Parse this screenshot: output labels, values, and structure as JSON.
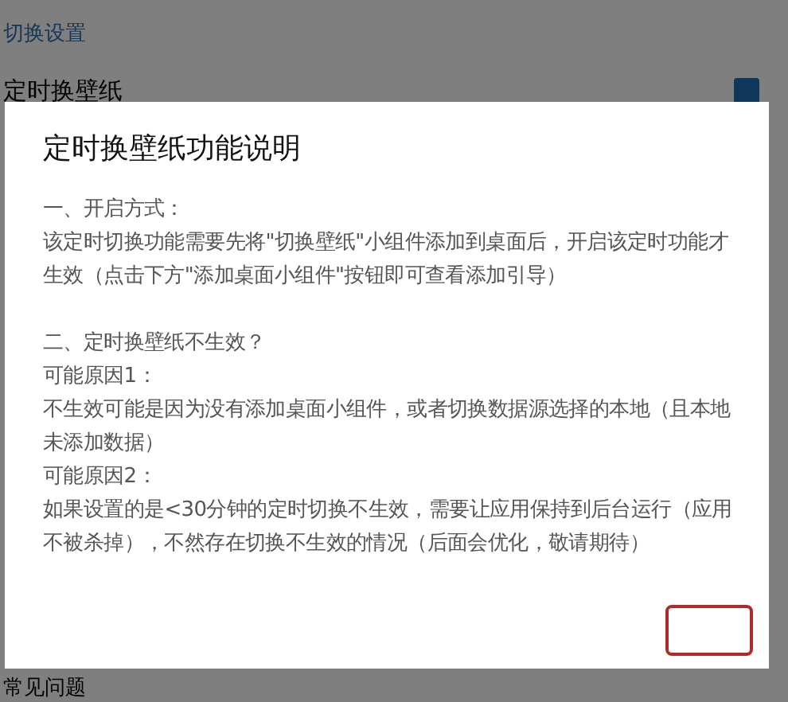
{
  "page": {
    "section_title": "切换设置",
    "setting": {
      "label": "定时换壁纸",
      "checked": true
    },
    "bottom_item": "常见问题"
  },
  "dialog": {
    "title": "定时换壁纸功能说明",
    "paragraphs": [
      {
        "kind": "line",
        "text": "一、开启方式："
      },
      {
        "kind": "line",
        "text": "该定时切换功能需要先将\"切换壁纸\"小组件添加到桌面后，开启该定时功能才生效（点击下方\"添加桌面小组件\"按钮即可查看添加引导）"
      },
      {
        "kind": "gap"
      },
      {
        "kind": "line",
        "text": "二、定时换壁纸不生效？"
      },
      {
        "kind": "line",
        "text": "可能原因1："
      },
      {
        "kind": "line",
        "text": "不生效可能是因为没有添加桌面小组件，或者切换数据源选择的本地（且本地未添加数据）"
      },
      {
        "kind": "line",
        "text": "可能原因2："
      },
      {
        "kind": "line",
        "text": "如果设置的是<30分钟的定时切换不生效，需要让应用保持到后台运行（应用不被杀掉），不然存在切换不生效的情况（后面会优化，敬请期待）"
      }
    ],
    "buttons": [
      {
        "kind": "outlined"
      }
    ]
  }
}
